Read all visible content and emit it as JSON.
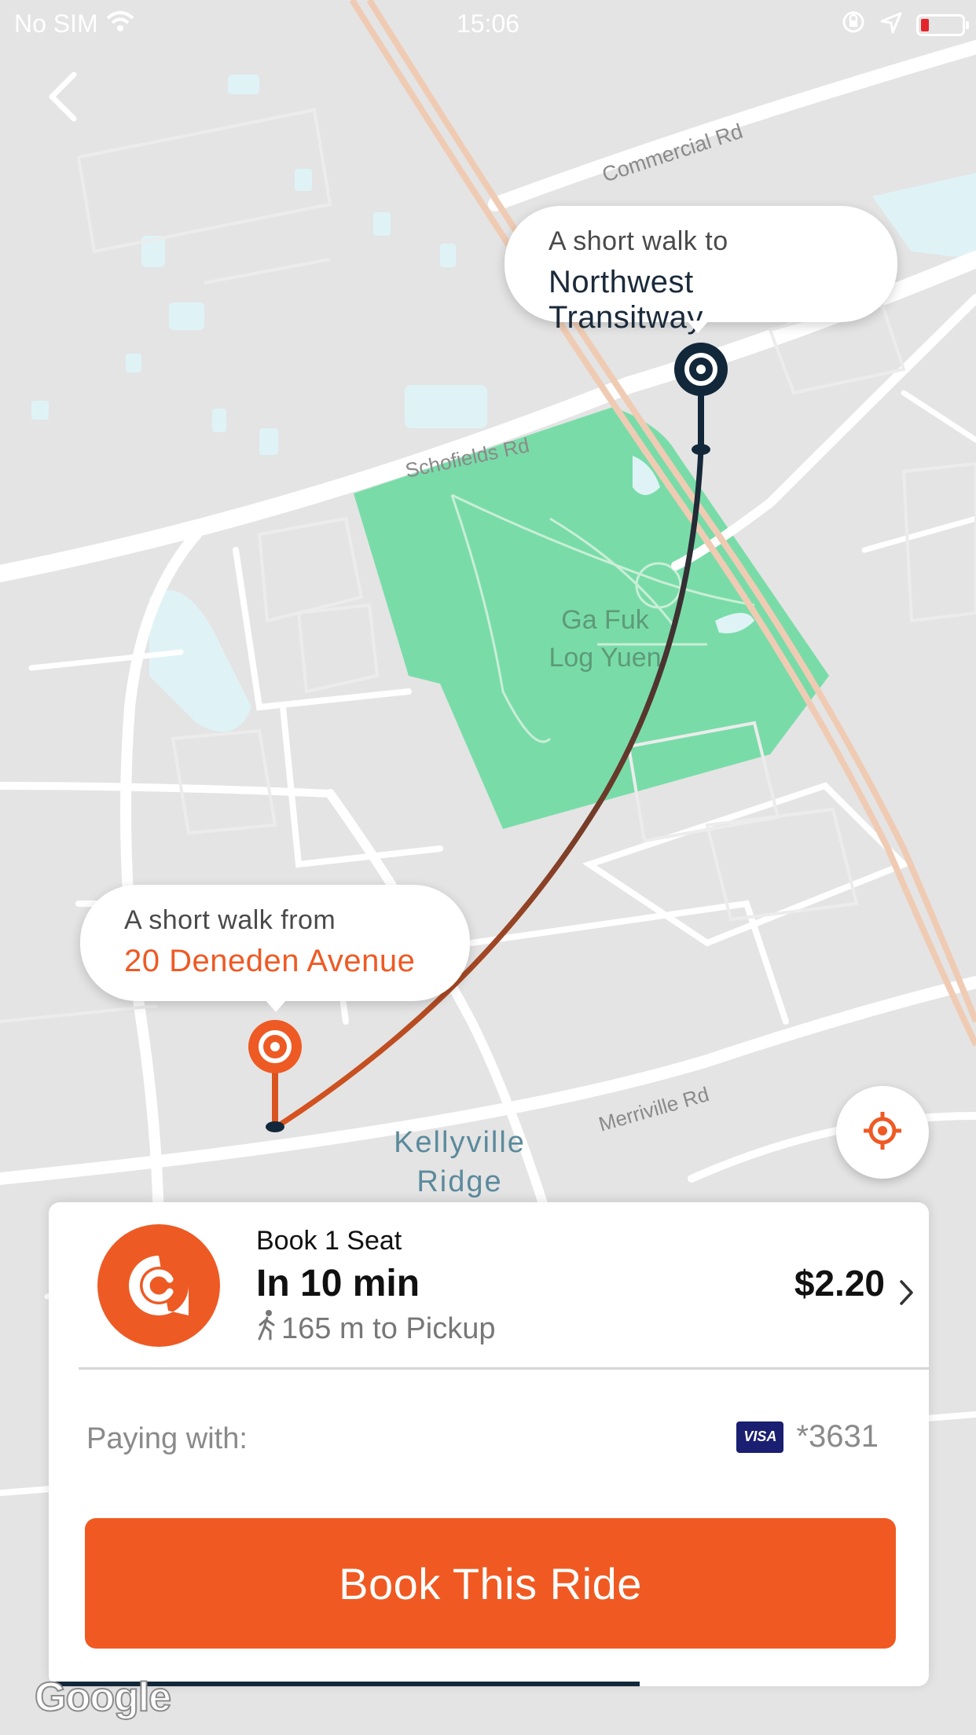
{
  "status_bar": {
    "carrier": "No SIM",
    "time": "15:06"
  },
  "map": {
    "labels": {
      "commercial_rd": "Commercial Rd",
      "schofields_rd": "Schofields Rd",
      "park_line1": "Ga Fuk",
      "park_line2": "Log Yuen",
      "merriville_rd": "Merriville Rd",
      "suburb_line1": "Kellyville",
      "suburb_line2": "Ridge"
    },
    "attribution": "Google"
  },
  "dropoff": {
    "line1": "A short walk to",
    "line2": "Northwest Transitway"
  },
  "pickup": {
    "line1": "A short walk from",
    "line2": "20 Deneden Avenue"
  },
  "ride": {
    "seat_label": "Book 1 Seat",
    "eta": "In 10 min",
    "walk": "165 m to Pickup",
    "price": "$2.20"
  },
  "payment": {
    "label": "Paying with:",
    "card_brand": "VISA",
    "card_number": "*3631"
  },
  "book_button": "Book This Ride",
  "colors": {
    "accent": "#F05A22",
    "navy": "#12283A",
    "park": "#79DCA8"
  },
  "icons": [
    "back-icon",
    "wifi-icon",
    "rotation-lock-icon",
    "location-arrow-icon",
    "battery-icon",
    "locate-icon",
    "walk-icon",
    "chevron-right-icon",
    "ride-logo-icon"
  ]
}
